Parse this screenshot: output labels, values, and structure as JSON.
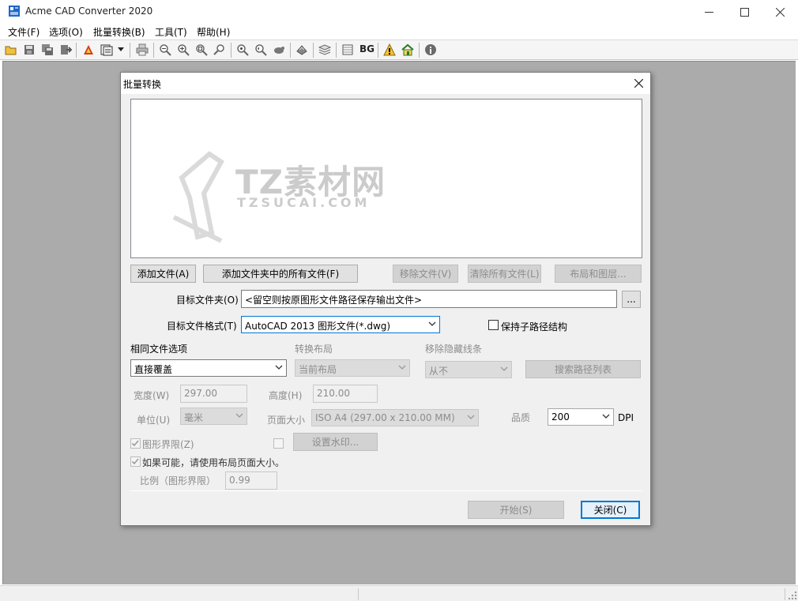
{
  "window": {
    "title": "Acme CAD Converter 2020",
    "controls": [
      "minimize",
      "maximize",
      "close"
    ]
  },
  "menu": [
    "文件(F)",
    "选项(O)",
    "批量转换(B)",
    "工具(T)",
    "帮助(H)"
  ],
  "toolbar": {
    "bg_label": "BG"
  },
  "dialog": {
    "title": "批量转换",
    "buttons": {
      "add_file": "添加文件(A)",
      "add_folder_files": "添加文件夹中的所有文件(F)",
      "remove_file": "移除文件(V)",
      "clear_all": "清除所有文件(L)",
      "layout_layers": "布局和图层...",
      "browse": "...",
      "search_path_list": "搜索路径列表",
      "set_watermark": "设置水印...",
      "start": "开始(S)",
      "close": "关闭(C)"
    },
    "target_folder": {
      "label": "目标文件夹(O)",
      "value": "<留空则按原图形文件路径保存输出文件>"
    },
    "target_format": {
      "label": "目标文件格式(T)",
      "value": "AutoCAD 2013 图形文件(*.dwg)"
    },
    "keep_subpath": {
      "label": "保持子路径结构",
      "checked": false
    },
    "same_file_options": {
      "label": "相同文件选项",
      "value": "直接覆盖"
    },
    "convert_layout": {
      "label": "转换布局",
      "value": "当前布局"
    },
    "remove_hidden_lines": {
      "label": "移除隐藏线条",
      "value": "从不"
    },
    "width": {
      "label": "宽度(W)",
      "value": "297.00"
    },
    "height": {
      "label": "高度(H)",
      "value": "210.00"
    },
    "unit": {
      "label": "单位(U)",
      "value": "毫米"
    },
    "page_size": {
      "label": "页面大小",
      "value": "ISO A4 (297.00 x 210.00 MM)"
    },
    "quality": {
      "label": "品质",
      "value": "200",
      "unit": "DPI"
    },
    "drawing_limits": {
      "label": "图形界限(Z)",
      "checked": true
    },
    "watermark_check": {
      "checked": false
    },
    "use_layout_size": {
      "label": "如果可能，请使用布局页面大小。",
      "checked": true
    },
    "scale": {
      "label": "比例（图形界限）",
      "value": "0.99"
    }
  },
  "watermark_overlay": {
    "brand": "TZ素材网",
    "domain": "TZSUCAI.COM"
  }
}
